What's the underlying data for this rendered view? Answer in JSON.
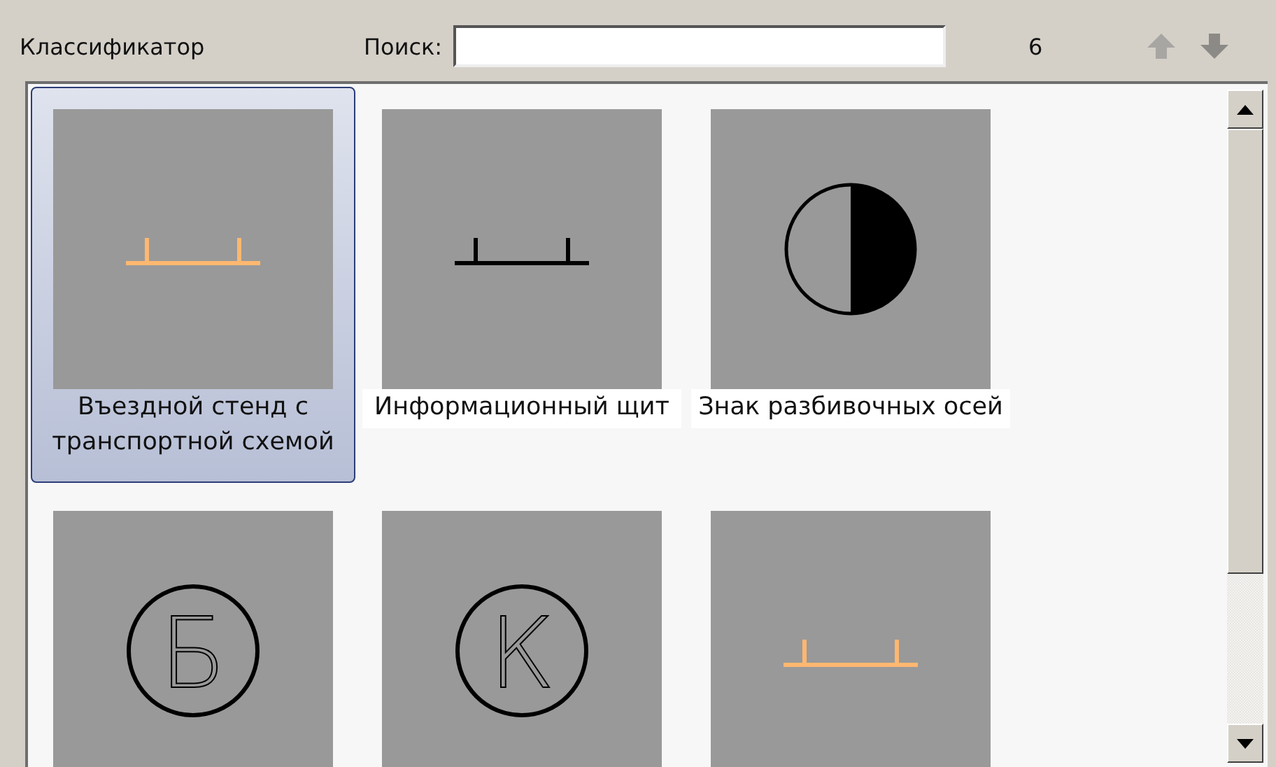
{
  "toolbar": {
    "title": "Классификатор",
    "search_label": "Поиск:",
    "count": "6"
  },
  "items": [
    {
      "label": "Въездной стенд с транспортной схемой",
      "selected": true,
      "kind": "stand",
      "color": "#ffb870"
    },
    {
      "label": "Информационный щит",
      "selected": false,
      "kind": "stand",
      "color": "#000000"
    },
    {
      "label": "Знак разбивочных осей",
      "selected": false,
      "kind": "half-circle"
    },
    {
      "selected": false,
      "kind": "letter-circle",
      "letter": "Б"
    },
    {
      "selected": false,
      "kind": "letter-circle",
      "letter": "К"
    },
    {
      "selected": false,
      "kind": "stand",
      "color": "#ffb870"
    }
  ]
}
